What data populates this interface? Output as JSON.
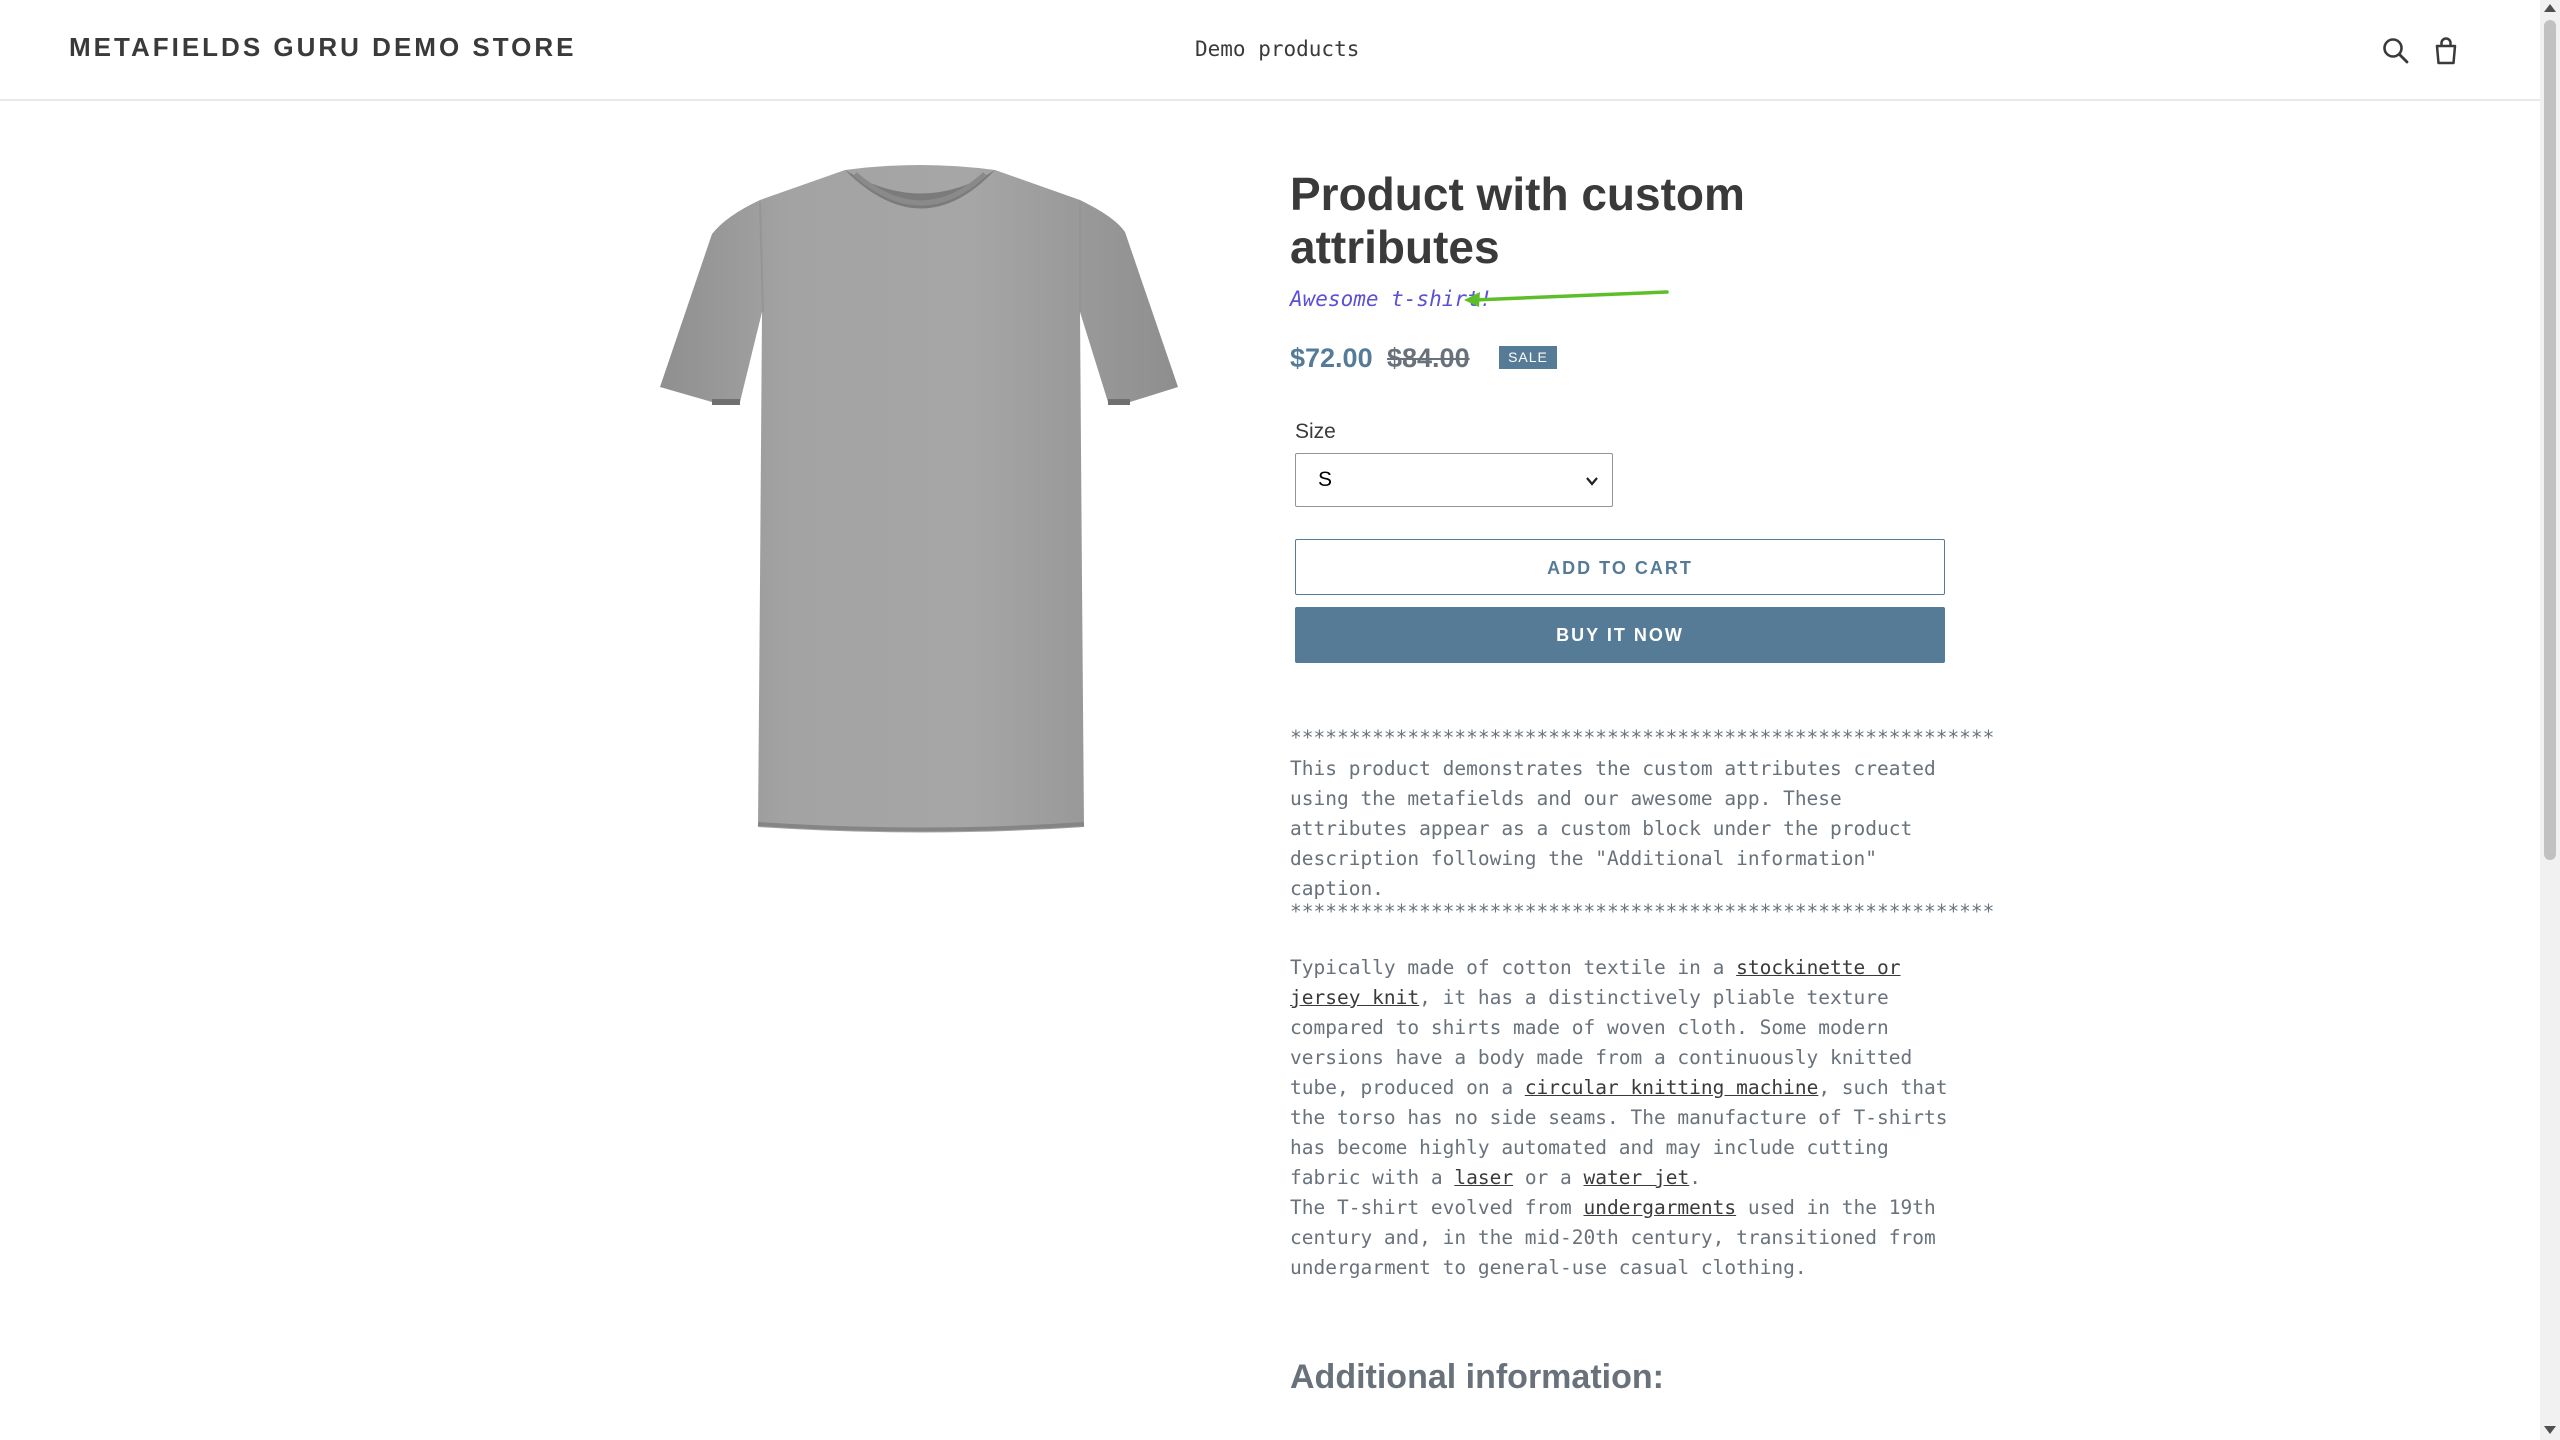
{
  "header": {
    "store_name": "METAFIELDS GURU DEMO STORE",
    "nav_link": "Demo products",
    "icons": [
      "search-icon",
      "cart-icon"
    ]
  },
  "product": {
    "title": "Product with custom attributes",
    "custom_attribute": "Awesome t-shirt!",
    "price_sale": "$72.00",
    "price_regular": "$84.00",
    "sale_badge": "SALE",
    "size_label": "Size",
    "size_selected": "S",
    "add_to_cart": "ADD TO CART",
    "buy_now": "BUY IT NOW"
  },
  "description": {
    "stars": "************************************************************",
    "intro": "This product demonstrates the custom attributes created using the metafields and our awesome app. These attributes appear as a custom block under the product description following the \"Additional information\" caption.",
    "p1_a": "Typically made of cotton textile in a ",
    "link_knit": "stockinette or jersey knit",
    "p1_b": ", it has a distinctively pliable texture compared to shirts made of woven cloth. Some modern versions have a body made from a continuously knitted tube, produced on a ",
    "link_circular": "circular knitting machine",
    "p1_c": ", such that the torso has no side seams. The manufacture of T-shirts has become highly automated and may include cutting fabric with a ",
    "link_laser": "laser",
    "p1_d": " or a ",
    "link_waterjet": "water jet",
    "p1_e": ".",
    "p2_a": "The T-shirt evolved from ",
    "link_undergarments": "undergarments",
    "p2_b": " used in the 19th century and, in the mid-20th century, transitioned from undergarment to general-use casual clothing."
  },
  "additional_info_heading": "Additional information:",
  "colors": {
    "accent": "#557b97",
    "custom_attribute": "#5b50d6",
    "arrow": "#5cbf2a"
  }
}
